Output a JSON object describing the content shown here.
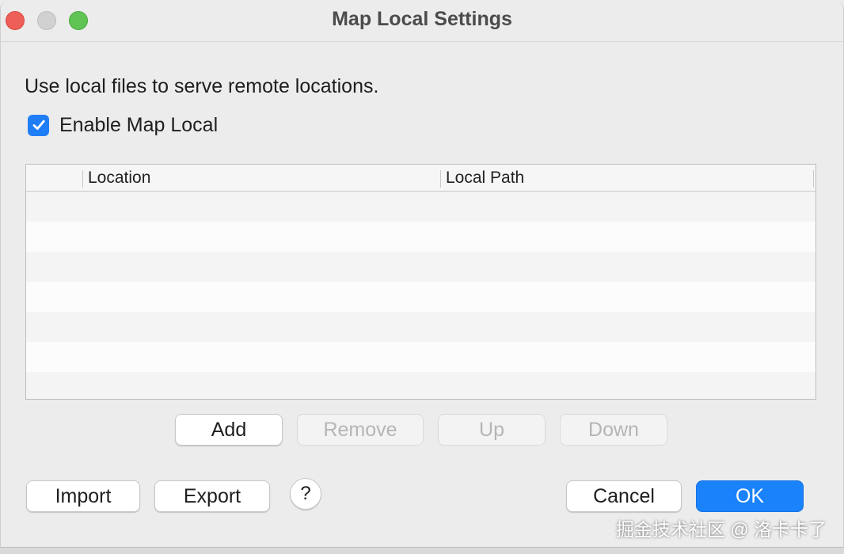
{
  "window": {
    "title": "Map Local Settings"
  },
  "description": "Use local files to serve remote locations.",
  "enable": {
    "label": "Enable Map Local",
    "checked": true
  },
  "table": {
    "columns": [
      "Location",
      "Local Path"
    ],
    "rows": []
  },
  "table_buttons": {
    "add": "Add",
    "remove": "Remove",
    "up": "Up",
    "down": "Down"
  },
  "footer": {
    "import": "Import",
    "export": "Export",
    "help": "?",
    "cancel": "Cancel",
    "ok": "OK"
  },
  "watermark": "掘金技术社区 @ 洛卡卡了",
  "colors": {
    "accent": "#1a82fb",
    "checkbox": "#1f7ef6",
    "close": "#ee5f57",
    "zoom": "#5fc454",
    "minimize_inactive": "#d1d1d1"
  }
}
